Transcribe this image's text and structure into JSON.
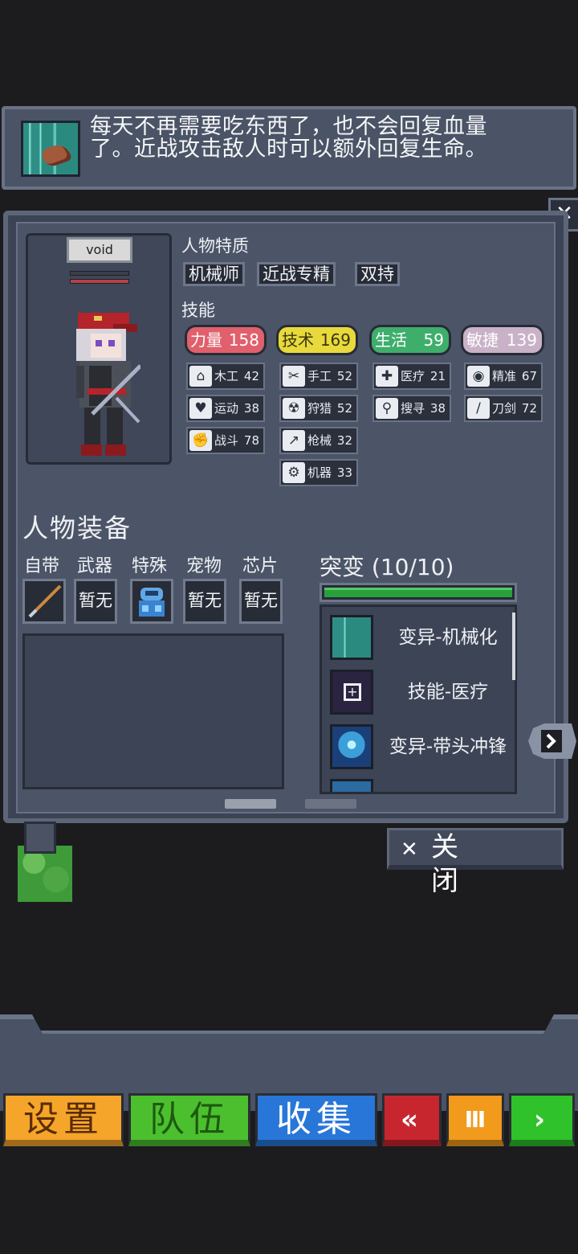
{
  "tooltip": {
    "icon": "mechanization-mutation-icon",
    "text_line1": "每天不再需要吃东西了，也不会回复血量",
    "text_line2": "了。近战攻击敌人时可以额外回复生命。"
  },
  "character": {
    "name": "void"
  },
  "traits": {
    "title": "人物特质",
    "items": [
      "机械师",
      "近战专精",
      "双持"
    ]
  },
  "skills": {
    "title": "技能",
    "stats": [
      {
        "label": "力量",
        "value": "158",
        "color": "#e0606c"
      },
      {
        "label": "技术",
        "value": "169",
        "color": "#e8d93c"
      },
      {
        "label": "生活",
        "value": "59",
        "color": "#3fae6c"
      },
      {
        "label": "敏捷",
        "value": "139",
        "color": "#c9b2c8"
      }
    ],
    "items": [
      {
        "icon": "house-icon",
        "glyph": "⌂",
        "label": "木工",
        "value": "42"
      },
      {
        "icon": "scissors-icon",
        "glyph": "✂",
        "label": "手工",
        "value": "52"
      },
      {
        "icon": "medkit-icon",
        "glyph": "✚",
        "label": "医疗",
        "value": "21"
      },
      {
        "icon": "eye-icon",
        "glyph": "◉",
        "label": "精准",
        "value": "67"
      },
      {
        "icon": "heart-icon",
        "glyph": "♥",
        "label": "运动",
        "value": "38"
      },
      {
        "icon": "radiation-icon",
        "glyph": "☢",
        "label": "狩猎",
        "value": "52"
      },
      {
        "icon": "magnifier-icon",
        "glyph": "⚲",
        "label": "搜寻",
        "value": "38"
      },
      {
        "icon": "sword-icon",
        "glyph": "/",
        "label": "刀剑",
        "value": "72"
      },
      {
        "icon": "fist-icon",
        "glyph": "✊",
        "label": "战斗",
        "value": "78"
      },
      {
        "icon": "gun-icon",
        "glyph": "↗",
        "label": "枪械",
        "value": "32"
      },
      {
        "icon": "gear-icon",
        "glyph": "⚙",
        "label": "机器",
        "value": "33"
      }
    ]
  },
  "equipment": {
    "title": "人物装备",
    "slot_labels": [
      "自带",
      "武器",
      "特殊",
      "宠物",
      "芯片"
    ],
    "slots": [
      "",
      "暂无",
      "",
      "暂无",
      "暂无"
    ]
  },
  "mutations": {
    "title": "突变",
    "count": "(10/10)",
    "fill_fraction": 1.0,
    "items": [
      {
        "icon": "mechanization-mutation-icon",
        "label": "变异-机械化"
      },
      {
        "icon": "medkit-icon",
        "label": "技能-医疗"
      },
      {
        "icon": "charge-leader-icon",
        "label": "变异-带头冲锋"
      }
    ]
  },
  "close_button": {
    "label": "关闭"
  },
  "bottom_nav": {
    "settings": "设置",
    "team": "队伍",
    "collect": "收集",
    "rewind": "«",
    "pause": "Ⅲ",
    "play": "›"
  }
}
